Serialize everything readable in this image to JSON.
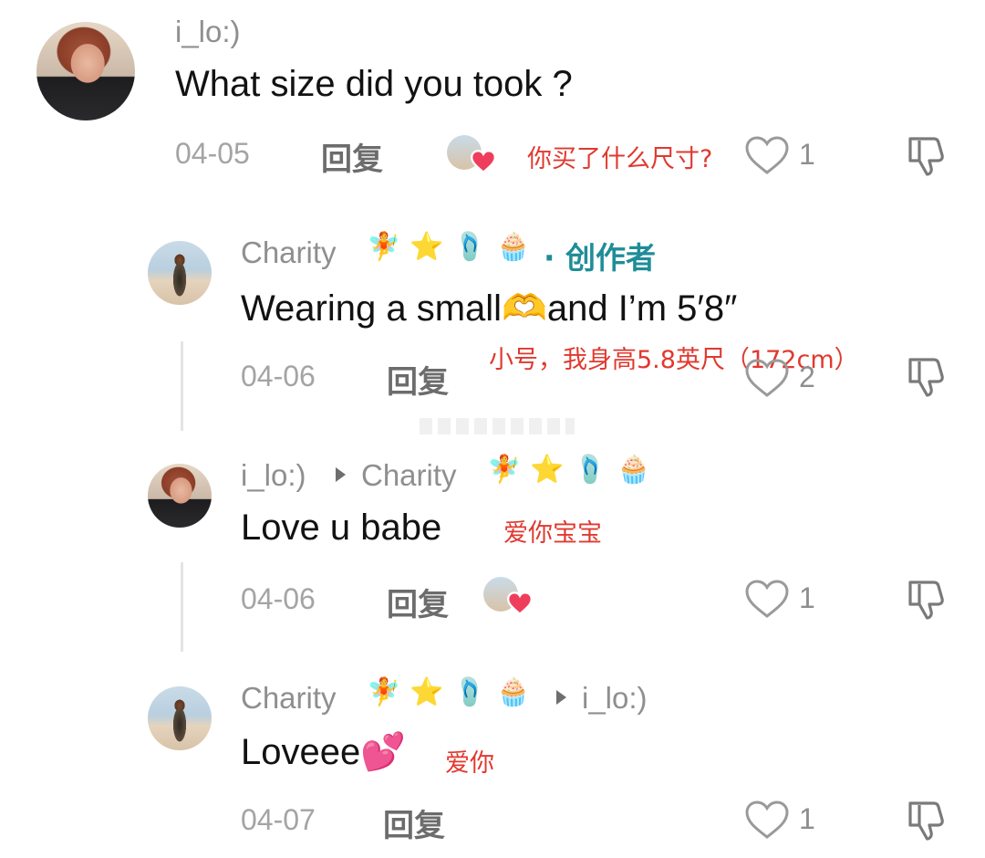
{
  "comments": [
    {
      "user": "i_lo:)",
      "text": "What size did you took ?",
      "date": "04-05",
      "reply_label": "回复",
      "annotation": "你买了什么尺寸?",
      "likes": "1"
    },
    {
      "user": "Charity",
      "creator_label": "· 创作者",
      "text": "Wearing a small🫶and I’m 5′8″",
      "date": "04-06",
      "reply_label": "回复",
      "annotation": "小号，我身高5.8英尺（172cm）",
      "likes": "2"
    },
    {
      "user": "i_lo:)",
      "reply_to": "Charity",
      "text": "Love u babe",
      "date": "04-06",
      "reply_label": "回复",
      "annotation": "爱你宝宝",
      "likes": "1"
    },
    {
      "user": "Charity",
      "reply_to": "i_lo:)",
      "text": "Loveee💕",
      "date": "04-07",
      "reply_label": "回复",
      "annotation": "爱你",
      "likes": "1"
    }
  ],
  "user_emojis": {
    "charity": [
      "🧚",
      "⭐",
      "🩴",
      "🧁"
    ]
  },
  "colors": {
    "username": "#8f8f8f",
    "creator": "#1f8d98",
    "annotation": "#e0392f",
    "heart": "#ef3e5c"
  }
}
